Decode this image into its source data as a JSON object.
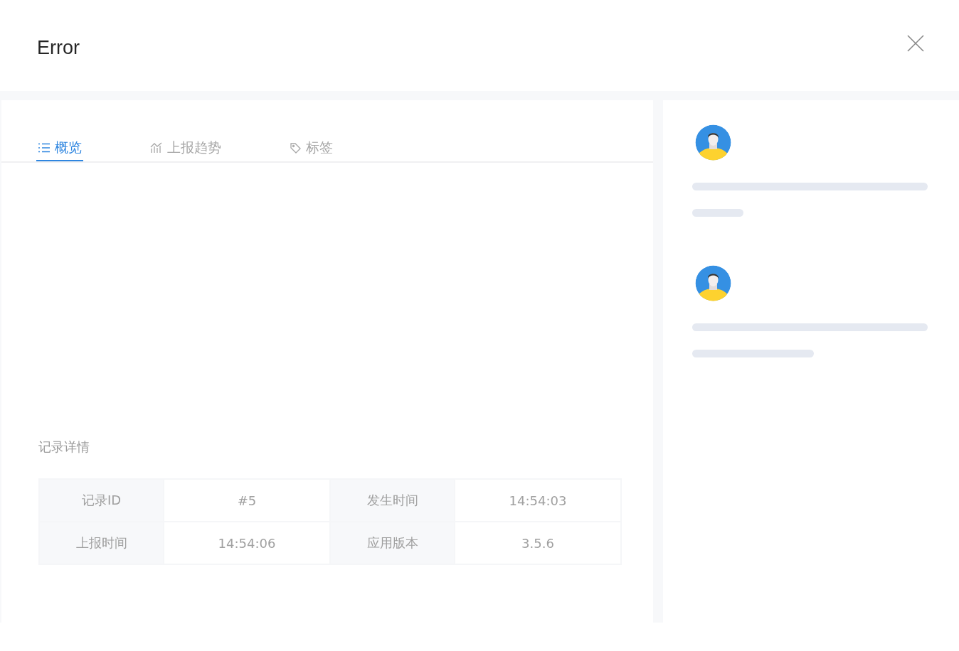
{
  "dialog": {
    "title": "Error"
  },
  "tabs": [
    {
      "label": "概览",
      "selected": true
    },
    {
      "label": "上报趋势",
      "selected": false
    },
    {
      "label": "标签",
      "selected": false
    }
  ],
  "details": {
    "title": "记录详情",
    "rows": [
      {
        "cells": [
          {
            "label": "记录ID",
            "value": "#5"
          },
          {
            "label": "发生时间",
            "value": "14:54:03"
          }
        ]
      },
      {
        "cells": [
          {
            "label": "上报时间",
            "value": "14:54:06"
          },
          {
            "label": "应用版本",
            "value": "3.5.6"
          }
        ]
      }
    ]
  },
  "sidebar": {
    "loading_cards": [
      {
        "kind": "skeleton"
      },
      {
        "kind": "skeleton"
      }
    ]
  }
}
